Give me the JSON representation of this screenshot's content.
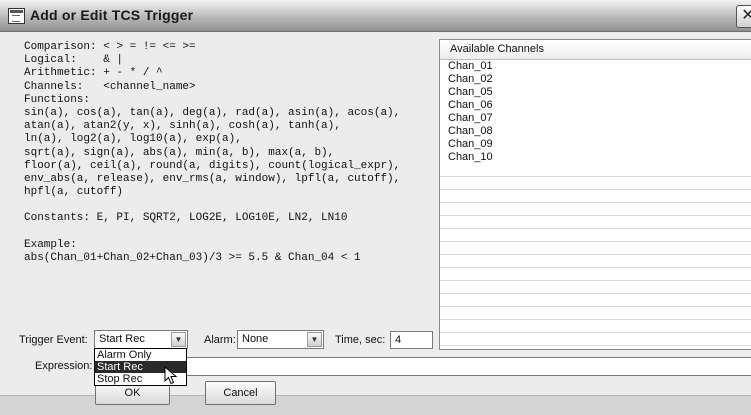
{
  "window": {
    "title": "Add or Edit TCS Trigger",
    "close_glyph": "✕"
  },
  "help_lines": [
    "Comparison: < > = != <= >=",
    "Logical:    & |",
    "Arithmetic: + - * / ^",
    "Channels:   <channel_name>",
    "Functions:",
    "sin(a), cos(a), tan(a), deg(a), rad(a), asin(a), acos(a),",
    "atan(a), atan2(y, x), sinh(a), cosh(a), tanh(a),",
    "ln(a), log2(a), log10(a), exp(a),",
    "sqrt(a), sign(a), abs(a), min(a, b), max(a, b),",
    "floor(a), ceil(a), round(a, digits), count(logical_expr),",
    "env_abs(a, release), env_rms(a, window), lpfl(a, cutoff),",
    "hpfl(a, cutoff)",
    "",
    "Constants: E, PI, SQRT2, LOG2E, LOG10E, LN2, LN10",
    "",
    "Example:",
    "abs(Chan_01+Chan_02+Chan_03)/3 >= 5.5 & Chan_04 < 1"
  ],
  "channels": {
    "header": "Available Channels",
    "items": [
      "Chan_01",
      "Chan_02",
      "Chan_05",
      "Chan_06",
      "Chan_07",
      "Chan_08",
      "Chan_09",
      "Chan_10"
    ]
  },
  "form": {
    "trigger_event_label": "Trigger Event:",
    "trigger_event_value": "Start Rec",
    "alarm_label": "Alarm:",
    "alarm_value": "None",
    "time_label": "Time, sec:",
    "time_value": "4",
    "expression_label": "Expression:",
    "expression_value": ""
  },
  "dropdown": {
    "options": [
      "Alarm Only",
      "Start Rec",
      "Stop Rec"
    ],
    "selected": "Start Rec"
  },
  "buttons": {
    "ok": "OK",
    "cancel": "Cancel"
  },
  "icons": {
    "combo_arrow": "▼",
    "app": "window-app-icon"
  }
}
